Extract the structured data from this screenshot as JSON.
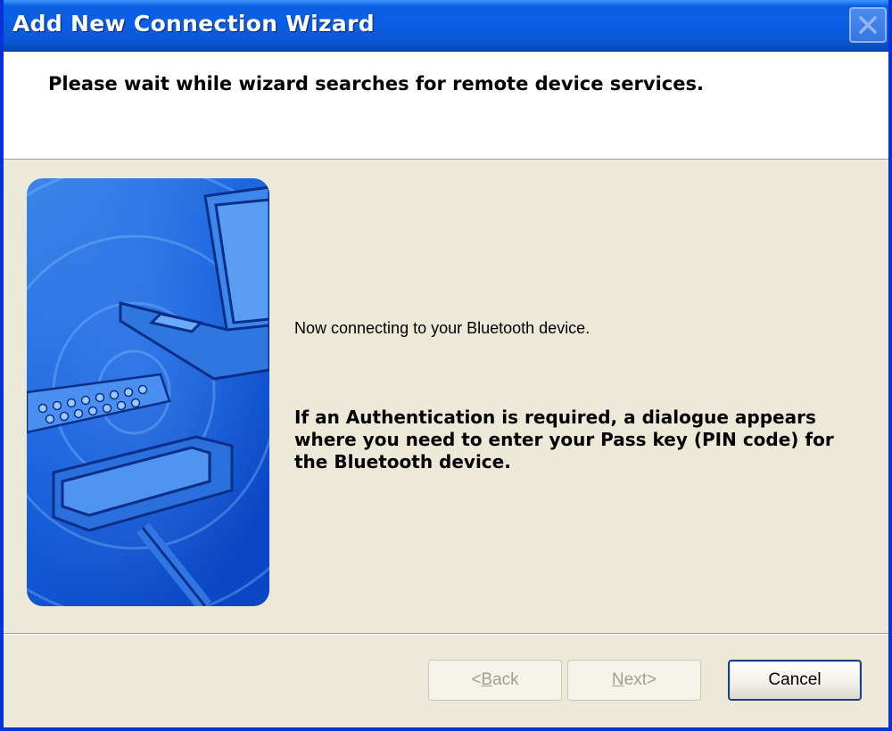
{
  "window": {
    "title": "Add New Connection Wizard"
  },
  "header": {
    "title": "Please wait while wizard searches for remote device services."
  },
  "content": {
    "message_status": "Now connecting to your Bluetooth device.",
    "message_auth": "If an Authentication is required, a dialogue appears where you need to enter your Pass key (PIN code) for the Bluetooth device."
  },
  "buttons": {
    "back": {
      "prefix": "< ",
      "mnemonic": "B",
      "rest": "ack",
      "enabled": false
    },
    "next": {
      "mnemonic": "N",
      "rest": "ext",
      "suffix": " >",
      "enabled": false
    },
    "cancel": {
      "label": "Cancel",
      "enabled": true
    }
  },
  "icons": {
    "close": "close-icon",
    "illustration": "bluetooth-laptop-illustration"
  },
  "colors": {
    "titlebar": "#0a5fe0",
    "frame": "#0831d9",
    "dialog_bg": "#ece9d8",
    "header_bg": "#ffffff"
  }
}
